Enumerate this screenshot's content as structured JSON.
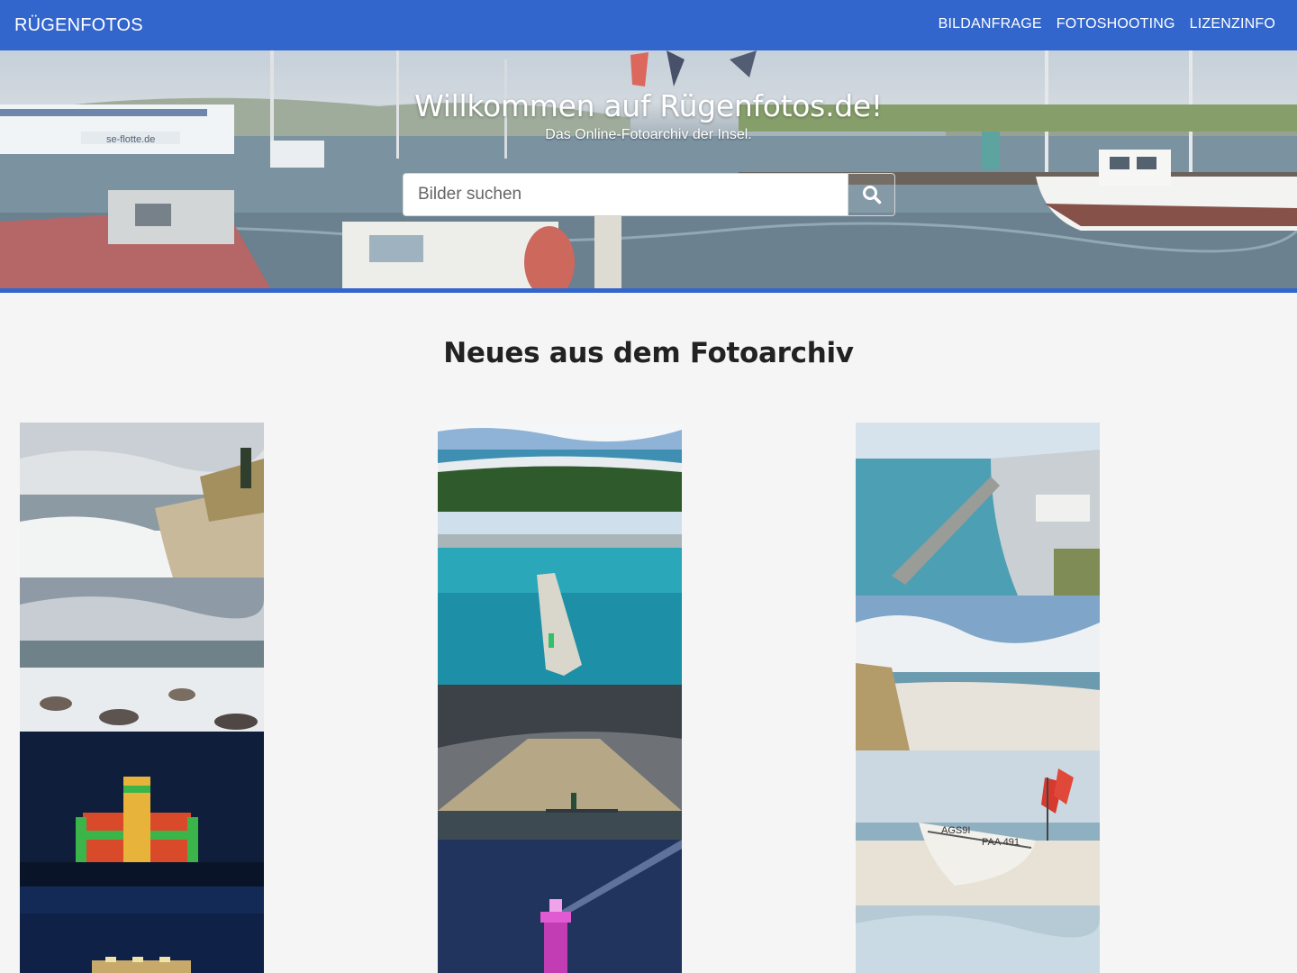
{
  "nav": {
    "brand": "RÜGENFOTOS",
    "links": [
      "BILDANFRAGE",
      "FOTOSHOOTING",
      "LIZENZINFO"
    ]
  },
  "hero": {
    "title": "Willkommen auf Rügenfotos.de!",
    "subtitle": "Das Online-Fotoarchiv der Insel.",
    "search_placeholder": "Bilder suchen",
    "search_icon": "search-icon",
    "boat_sign": "se-flotte.de"
  },
  "main": {
    "section_title": "Neues aus dem Fotoarchiv",
    "photos": [
      {
        "id": "photo-beach-dune-left",
        "subject": "beach with dune and grass"
      },
      {
        "id": "photo-aerial-forest-coast",
        "subject": "aerial view of forest and coast"
      },
      {
        "id": "photo-aerial-harbour-pier",
        "subject": "aerial view of harbour and pier"
      },
      {
        "id": "photo-aerial-mole-lighthouse",
        "subject": "aerial view of mole with green light"
      },
      {
        "id": "photo-waves-stones",
        "subject": "waves over stones"
      },
      {
        "id": "photo-beach-clouds",
        "subject": "beach under clouds"
      },
      {
        "id": "photo-lighthouse-sunrays",
        "subject": "lighthouse under sun rays"
      },
      {
        "id": "photo-castle-illuminated",
        "subject": "castle lit red and green at night"
      },
      {
        "id": "photo-fishing-boat-flags",
        "subject": "fishing boat with red flags on beach"
      },
      {
        "id": "photo-lighthouse-purple",
        "subject": "lighthouse lit purple at night"
      },
      {
        "id": "photo-building-night",
        "subject": "lit building at night"
      },
      {
        "id": "photo-sky-pale",
        "subject": "pale sky"
      }
    ],
    "boat_text": [
      "AGS9I",
      "PAA 491"
    ]
  },
  "colors": {
    "accent": "#3366cc",
    "background": "#f5f5f5"
  }
}
